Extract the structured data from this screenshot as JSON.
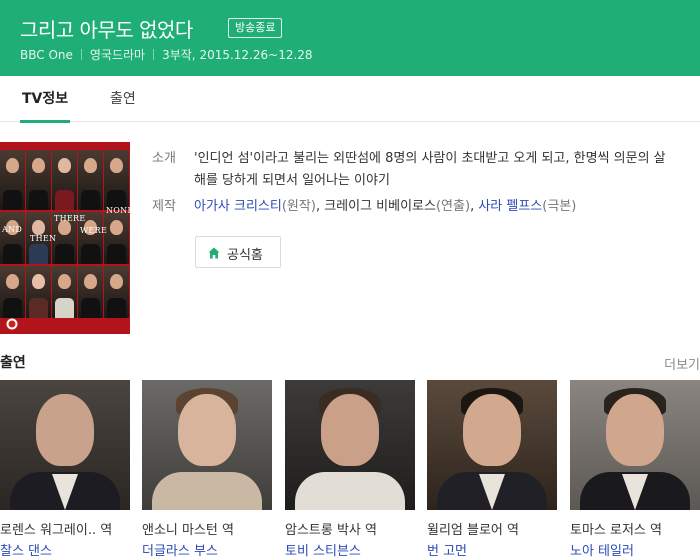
{
  "header": {
    "title": "그리고 아무도 없었다",
    "badge": "방송종료",
    "channel": "BBC One",
    "genre": "영국드라마",
    "episodes_dates": "3부작, 2015.12.26~12.28",
    "bg_color": "#1fae75"
  },
  "tabs": [
    {
      "label": "TV정보",
      "active": true
    },
    {
      "label": "출연",
      "active": false
    }
  ],
  "poster": {
    "words": [
      "AND",
      "THEN",
      "THERE",
      "WERE",
      "NONE"
    ]
  },
  "info": {
    "intro_label": "소개",
    "intro_text": "'인디언 섬'이라고 불리는 외딴섬에 8명의 사람이 초대받고 오게 되고, 한명씩 의문의 살해를 당하게 되면서 일어나는 이야기",
    "credits_label": "제작",
    "credits": [
      {
        "name": "아가사 크리스티",
        "role": "(원작)"
      },
      {
        "name": "크레이그 비베이로스",
        "role": "(연출)"
      },
      {
        "name": "사라 펠프스",
        "role": "(극본)"
      }
    ],
    "home_button": "공식홈",
    "home_icon": "house-icon"
  },
  "cast": {
    "title": "출연",
    "more": "더보기",
    "items": [
      {
        "role": "로렌스 워그레이.. 역",
        "actor": "찰스 댄스"
      },
      {
        "role": "앤소니 마스턴 역",
        "actor": "더글라스 부스"
      },
      {
        "role": "암스트롱 박사 역",
        "actor": "토비 스티븐스"
      },
      {
        "role": "윌리엄 블로어 역",
        "actor": "번 고먼"
      },
      {
        "role": "토마스 로저스 역",
        "actor": "노아 테일러"
      }
    ]
  }
}
